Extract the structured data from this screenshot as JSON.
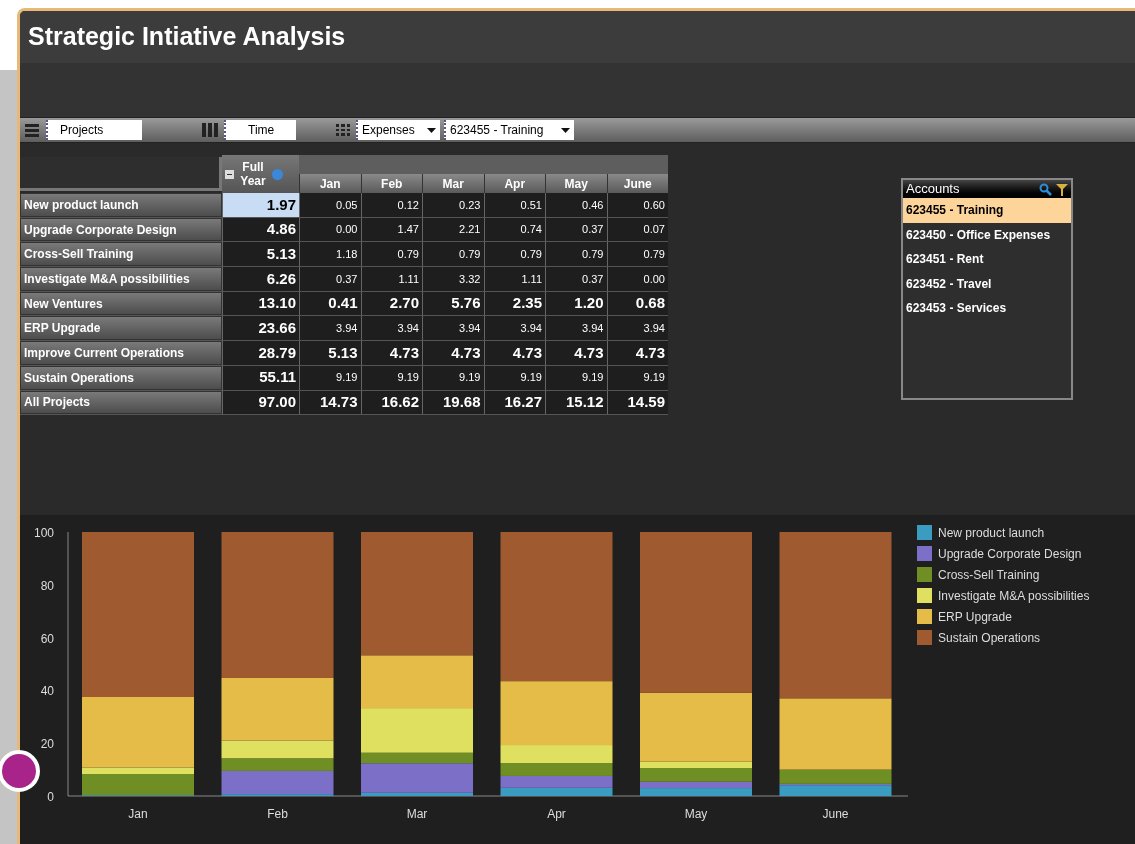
{
  "window": {
    "title": "Strategic Intiative Analysis"
  },
  "toolbar": {
    "rows_field": "Projects",
    "columns_field": "Time",
    "measure_dropdown": "Expenses",
    "account_dropdown": "623455 - Training"
  },
  "table": {
    "columns": [
      "Full Year",
      "Jan",
      "Feb",
      "Mar",
      "Apr",
      "May",
      "June"
    ],
    "rows": [
      {
        "label": "New product launch",
        "selected": true,
        "emphasis": false,
        "values": [
          "1.97",
          "0.05",
          "0.12",
          "0.23",
          "0.51",
          "0.46",
          "0.60"
        ]
      },
      {
        "label": "Upgrade Corporate Design",
        "selected": false,
        "emphasis": false,
        "values": [
          "4.86",
          "0.00",
          "1.47",
          "2.21",
          "0.74",
          "0.37",
          "0.07"
        ]
      },
      {
        "label": "Cross-Sell Training",
        "selected": false,
        "emphasis": false,
        "values": [
          "5.13",
          "1.18",
          "0.79",
          "0.79",
          "0.79",
          "0.79",
          "0.79"
        ]
      },
      {
        "label": "Investigate M&A possibilities",
        "selected": false,
        "emphasis": false,
        "values": [
          "6.26",
          "0.37",
          "1.11",
          "3.32",
          "1.11",
          "0.37",
          "0.00"
        ]
      },
      {
        "label": "New Ventures",
        "selected": false,
        "emphasis": true,
        "values": [
          "13.10",
          "0.41",
          "2.70",
          "5.76",
          "2.35",
          "1.20",
          "0.68"
        ]
      },
      {
        "label": "ERP Upgrade",
        "selected": false,
        "emphasis": false,
        "values": [
          "23.66",
          "3.94",
          "3.94",
          "3.94",
          "3.94",
          "3.94",
          "3.94"
        ]
      },
      {
        "label": "Improve Current Operations",
        "selected": false,
        "emphasis": true,
        "values": [
          "28.79",
          "5.13",
          "4.73",
          "4.73",
          "4.73",
          "4.73",
          "4.73"
        ]
      },
      {
        "label": "Sustain Operations",
        "selected": false,
        "emphasis": false,
        "values": [
          "55.11",
          "9.19",
          "9.19",
          "9.19",
          "9.19",
          "9.19",
          "9.19"
        ]
      },
      {
        "label": "All Projects",
        "selected": false,
        "emphasis": true,
        "values": [
          "97.00",
          "14.73",
          "16.62",
          "19.68",
          "16.27",
          "15.12",
          "14.59"
        ]
      }
    ]
  },
  "accounts": {
    "title": "Accounts",
    "items": [
      {
        "label": "623455 - Training",
        "selected": true
      },
      {
        "label": "623450 - Office Expenses",
        "selected": false
      },
      {
        "label": "623451 - Rent",
        "selected": false
      },
      {
        "label": "623452 - Travel",
        "selected": false
      },
      {
        "label": "623453 - Services",
        "selected": false
      }
    ]
  },
  "chart": {
    "chart_data": {
      "type": "bar",
      "stacked": true,
      "legend": true,
      "categories": [
        "Jan",
        "Feb",
        "Mar",
        "Apr",
        "May",
        "June"
      ],
      "ylim": [
        0,
        100
      ],
      "yticks": [
        0,
        20,
        40,
        60,
        80,
        100
      ],
      "series": [
        {
          "name": "New product launch",
          "color": "#3a9cc0",
          "values": [
            0.3,
            0.7,
            1.2,
            3.1,
            3.0,
            4.1
          ]
        },
        {
          "name": "Upgrade Corporate Design",
          "color": "#7c6fc8",
          "values": [
            0.0,
            8.8,
            11.2,
            4.5,
            2.4,
            0.5
          ]
        },
        {
          "name": "Cross-Sell Training",
          "color": "#6f8f24",
          "values": [
            8.0,
            4.8,
            4.0,
            4.9,
            5.2,
            5.4
          ]
        },
        {
          "name": "Investigate M&A possibilities",
          "color": "#e0e060",
          "values": [
            2.5,
            6.7,
            16.9,
            6.8,
            2.4,
            0.0
          ]
        },
        {
          "name": "ERP Upgrade",
          "color": "#e6bc48",
          "values": [
            26.7,
            23.7,
            20.0,
            24.2,
            26.1,
            27.0
          ]
        },
        {
          "name": "Sustain Operations",
          "color": "#a05a30",
          "values": [
            62.5,
            55.3,
            46.7,
            56.5,
            60.9,
            63.0
          ]
        }
      ]
    }
  }
}
